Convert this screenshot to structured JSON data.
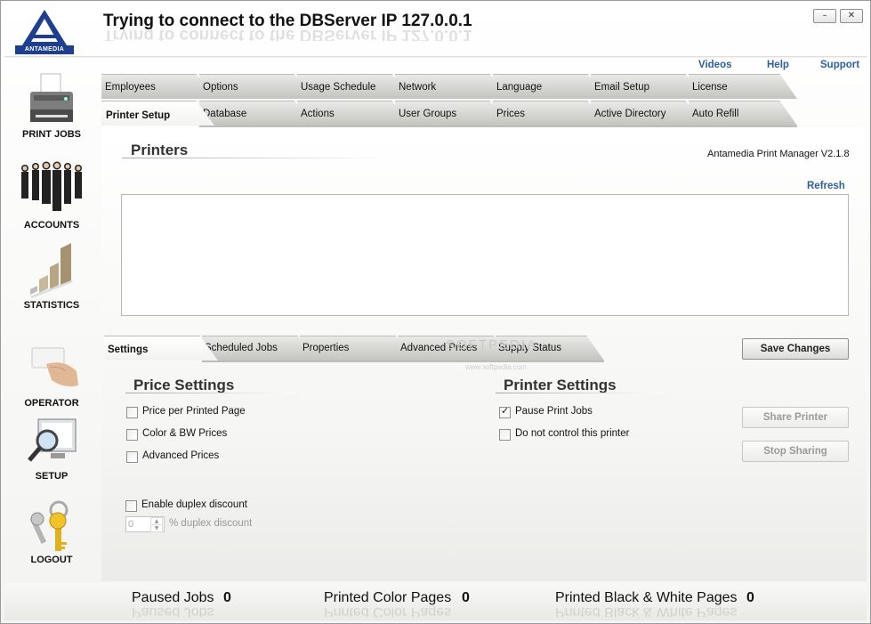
{
  "window": {
    "title": "Trying to connect to the DBServer IP 127.0.0.1",
    "logo_text": "ANTAMEDIA",
    "minimize": "–",
    "close": "✕"
  },
  "sidebar": {
    "items": [
      {
        "label": "PRINT JOBS",
        "icon": "printer-icon"
      },
      {
        "label": "ACCOUNTS",
        "icon": "people-icon"
      },
      {
        "label": "STATISTICS",
        "icon": "bar-chart-icon"
      },
      {
        "label": "OPERATOR",
        "icon": "card-hand-icon"
      },
      {
        "label": "SETUP",
        "icon": "magnifier-monitor-icon"
      },
      {
        "label": "LOGOUT",
        "icon": "keys-icon"
      }
    ]
  },
  "top_links": {
    "videos": "Videos",
    "help": "Help",
    "support": "Support"
  },
  "tabs_row1": [
    "Employees",
    "Options",
    "Usage Schedule",
    "Network",
    "Language",
    "Email Setup",
    "License"
  ],
  "tabs_row2": [
    "Printer Setup",
    "Database",
    "Actions",
    "User Groups",
    "Prices",
    "Active Directory",
    "Auto Refill"
  ],
  "printers": {
    "title": "Printers",
    "version": "Antamedia Print Manager V2.1.8",
    "refresh": "Refresh"
  },
  "subtabs": [
    "Settings",
    "Scheduled Jobs",
    "Properties",
    "Advanced Prices",
    "Supply Status"
  ],
  "save_changes": "Save Changes",
  "price_settings": {
    "title": "Price Settings",
    "options": [
      {
        "label": "Price per Printed Page",
        "checked": false
      },
      {
        "label": "Color & BW Prices",
        "checked": false
      },
      {
        "label": "Advanced Prices",
        "checked": false
      }
    ],
    "duplex": {
      "label": "Enable duplex discount",
      "checked": false,
      "value": "0",
      "unit_label": "% duplex discount"
    }
  },
  "printer_settings": {
    "title": "Printer Settings",
    "options": [
      {
        "label": "Pause Print Jobs",
        "checked": true
      },
      {
        "label": "Do not control this printer",
        "checked": false
      }
    ],
    "share_button": "Share Printer",
    "stop_sharing_button": "Stop Sharing"
  },
  "watermark": {
    "main": "SOFTPEDIA",
    "sub": "www.softpedia.com"
  },
  "stats": {
    "paused_jobs": {
      "label": "Paused Jobs",
      "value": "0"
    },
    "color_pages": {
      "label": "Printed Color Pages",
      "value": "0"
    },
    "bw_pages": {
      "label": "Printed Black & White Pages",
      "value": "0"
    }
  },
  "colors": {
    "link": "#2e5f9c",
    "tab": "#c4c4bf"
  }
}
